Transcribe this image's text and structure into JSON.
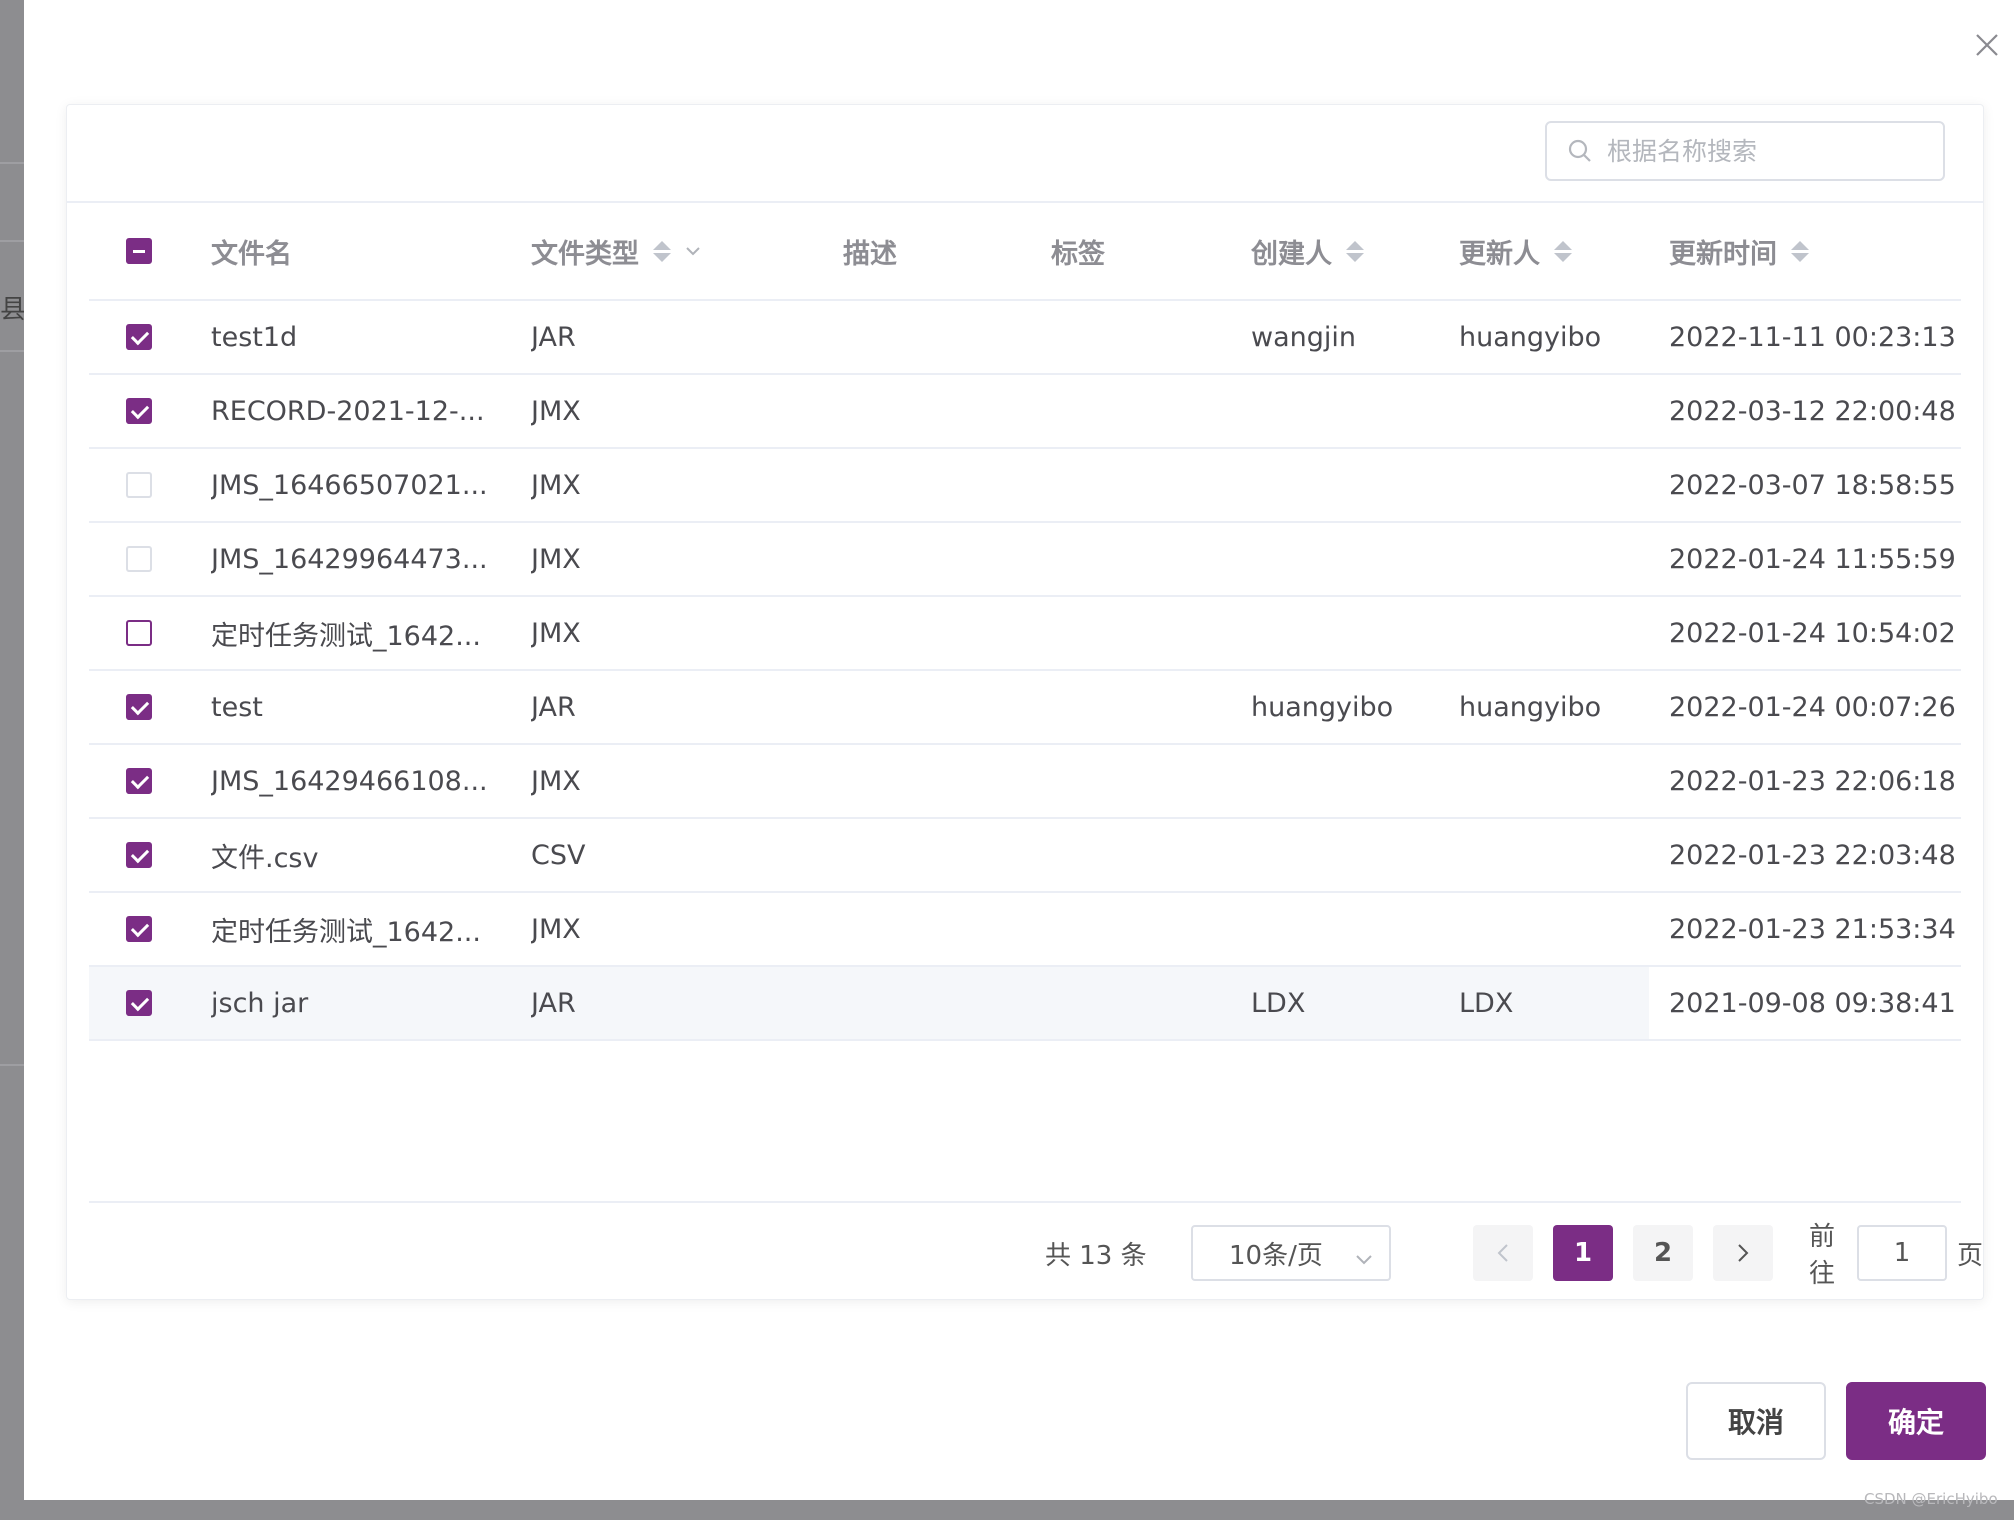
{
  "backdrop": {
    "fragment_text": "县名"
  },
  "search": {
    "placeholder": "根据名称搜索"
  },
  "table": {
    "columns": {
      "name": "文件名",
      "type": "文件类型",
      "desc": "描述",
      "tag": "标签",
      "creator": "创建人",
      "updater": "更新人",
      "time": "更新时间"
    },
    "rows": [
      {
        "checked": true,
        "name": "test1d",
        "type": "JAR",
        "desc": "",
        "tag": "",
        "creator": "wangjin",
        "updater": "huangyibo",
        "time": "2022-11-11 00:23:13"
      },
      {
        "checked": true,
        "name": "RECORD-2021-12-...",
        "type": "JMX",
        "desc": "",
        "tag": "",
        "creator": "",
        "updater": "",
        "time": "2022-03-12 22:00:48"
      },
      {
        "checked": false,
        "name": "JMS_16466507021...",
        "type": "JMX",
        "desc": "",
        "tag": "",
        "creator": "",
        "updater": "",
        "time": "2022-03-07 18:58:55"
      },
      {
        "checked": false,
        "name": "JMS_16429964473...",
        "type": "JMX",
        "desc": "",
        "tag": "",
        "creator": "",
        "updater": "",
        "time": "2022-01-24 11:55:59"
      },
      {
        "checked": false,
        "name": "定时任务测试_1642...",
        "type": "JMX",
        "desc": "",
        "tag": "",
        "creator": "",
        "updater": "",
        "time": "2022-01-24 10:54:02"
      },
      {
        "checked": true,
        "name": "test",
        "type": "JAR",
        "desc": "",
        "tag": "",
        "creator": "huangyibo",
        "updater": "huangyibo",
        "time": "2022-01-24 00:07:26"
      },
      {
        "checked": true,
        "name": "JMS_16429466108...",
        "type": "JMX",
        "desc": "",
        "tag": "",
        "creator": "",
        "updater": "",
        "time": "2022-01-23 22:06:18"
      },
      {
        "checked": true,
        "name": "文件.csv",
        "type": "CSV",
        "desc": "",
        "tag": "",
        "creator": "",
        "updater": "",
        "time": "2022-01-23 22:03:48"
      },
      {
        "checked": true,
        "name": "定时任务测试_1642...",
        "type": "JMX",
        "desc": "",
        "tag": "",
        "creator": "",
        "updater": "",
        "time": "2022-01-23 21:53:34"
      },
      {
        "checked": true,
        "name": "jsch jar",
        "type": "JAR",
        "desc": "",
        "tag": "",
        "creator": "LDX",
        "updater": "LDX",
        "time": "2021-09-08 09:38:41"
      }
    ]
  },
  "pagination": {
    "total_text": "共 13 条",
    "page_size": "10条/页",
    "pages": [
      "1",
      "2"
    ],
    "current_page": "1",
    "goto_label": "前往",
    "goto_value": "1",
    "page_suffix": "页"
  },
  "footer": {
    "cancel_label": "取消",
    "confirm_label": "确定"
  },
  "watermark": "CSDN @EricHyibo",
  "colors": {
    "primary": "#7b2d85",
    "border": "#dcdfe6",
    "row_hover": "#f5f7fa"
  }
}
